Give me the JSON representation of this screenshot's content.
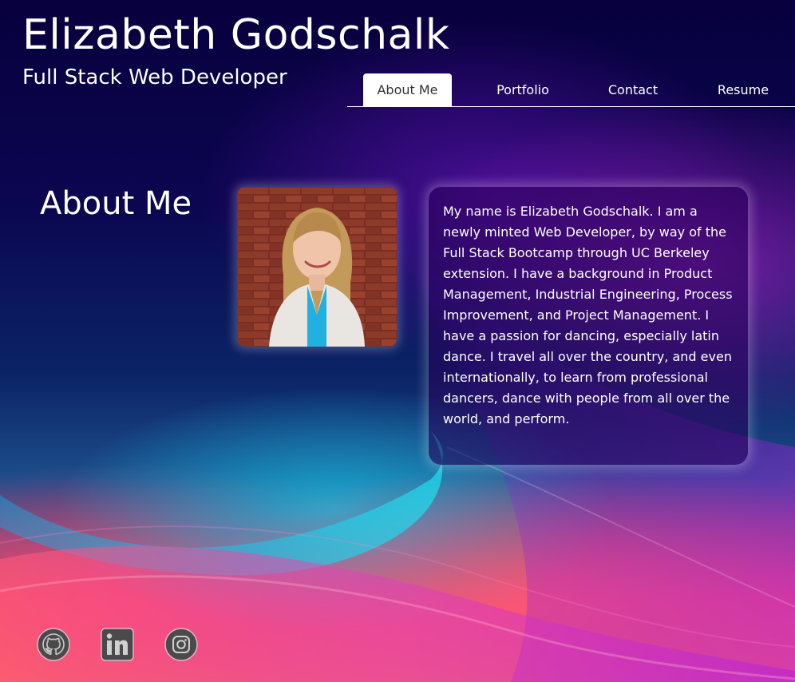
{
  "header": {
    "name": "Elizabeth Godschalk",
    "role": "Full Stack Web Developer"
  },
  "nav": {
    "tabs": [
      {
        "label": "About Me",
        "active": true
      },
      {
        "label": "Portfolio",
        "active": false
      },
      {
        "label": "Contact",
        "active": false
      },
      {
        "label": "Resume",
        "active": false
      }
    ]
  },
  "about": {
    "heading": "About Me",
    "bio": "My name is Elizabeth Godschalk. I am a newly minted Web Developer, by way of the Full Stack Bootcamp through UC Berkeley extension. I have a background in Product Management, Industrial Engineering, Process Improvement, and Project Management. I have a passion for dancing, especially latin dance. I travel all over the country, and even internationally, to learn from professional dancers, dance with people from all over the world, and perform."
  },
  "social": [
    {
      "icon": "github-icon"
    },
    {
      "icon": "linkedin-icon"
    },
    {
      "icon": "instagram-icon"
    }
  ],
  "colors": {
    "background_top": "#08003d",
    "accent_pink": "#f06a9c",
    "accent_cyan": "#14c8e6",
    "active_tab_bg": "#ffffff",
    "active_tab_text": "#333333",
    "icon_gray": "#4a4a4a"
  }
}
